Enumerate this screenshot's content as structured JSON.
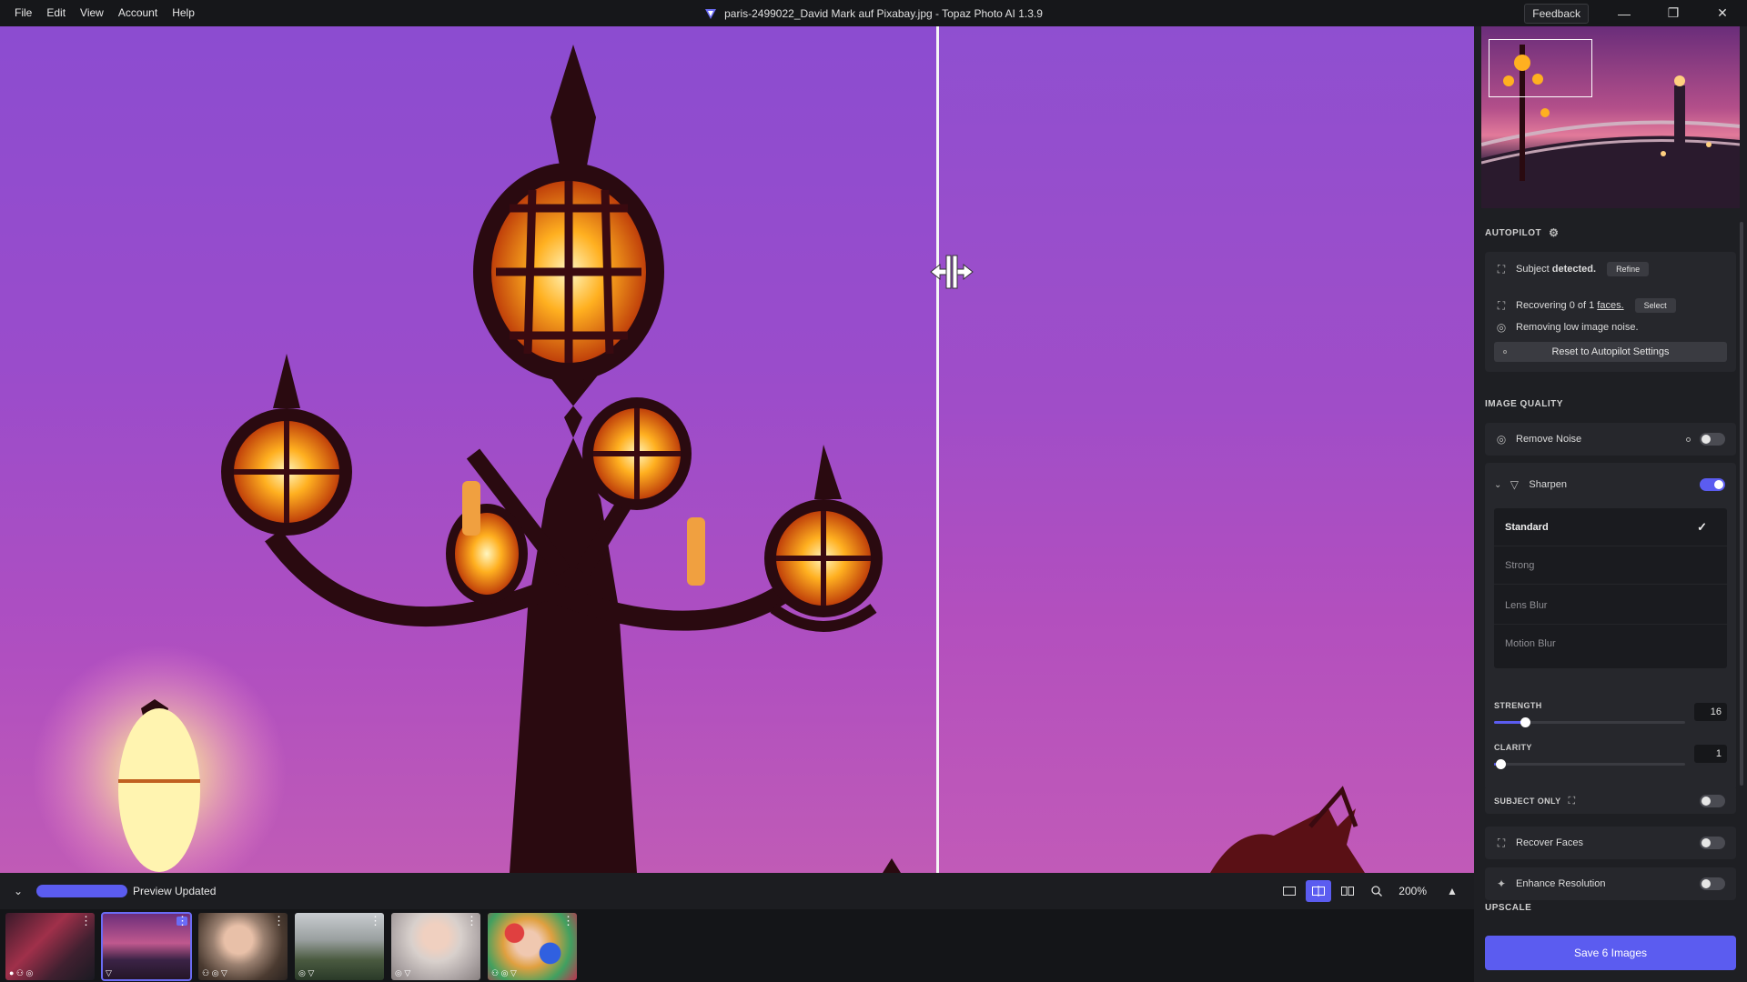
{
  "menu": [
    "File",
    "Edit",
    "View",
    "Account",
    "Help"
  ],
  "window_title": "paris-2499022_David Mark auf Pixabay.jpg - Topaz Photo AI 1.3.9",
  "feedback_label": "Feedback",
  "window_controls": {
    "minimize": "—",
    "restore": "❐",
    "close": "✕"
  },
  "colors": {
    "accent": "#5b5cf0",
    "panel": "#1e1f23",
    "sky_top": "#8f4fd0",
    "sky_bottom": "#c15ab8"
  },
  "bottom_bar": {
    "status": "Preview Updated",
    "progress": 1.0,
    "zoom": "200%"
  },
  "filmstrip": [
    {
      "name": "street-night",
      "selected": false
    },
    {
      "name": "paris-bridge",
      "selected": true
    },
    {
      "name": "baby-portrait",
      "selected": false
    },
    {
      "name": "landscape-tree",
      "selected": false
    },
    {
      "name": "child-portrait",
      "selected": false
    },
    {
      "name": "toddler-balls",
      "selected": false
    }
  ],
  "panel": {
    "autopilot": {
      "label": "AUTOPILOT",
      "subject_prefix": "Subject",
      "subject_suffix": "detected.",
      "refine_label": "Refine",
      "faces_text": "Recovering 0 of 1",
      "faces_link": "faces.",
      "select_label": "Select",
      "noise_text": "Removing low image noise.",
      "reset_label": "Reset to Autopilot Settings"
    },
    "image_quality": {
      "label": "IMAGE QUALITY",
      "remove_noise": "Remove Noise",
      "sharpen": "Sharpen",
      "models": [
        "Standard",
        "Strong",
        "Lens Blur",
        "Motion Blur"
      ],
      "selected_model": 0,
      "strength_label": "STRENGTH",
      "strength_value": "16",
      "strength_fraction": 0.16,
      "clarity_label": "CLARITY",
      "clarity_value": "1",
      "clarity_fraction": 0.01,
      "subject_only_label": "SUBJECT ONLY",
      "recover_faces": "Recover Faces",
      "enhance_resolution": "Enhance Resolution"
    },
    "upscale_label": "UPSCALE",
    "save_label": "Save 6 Images"
  }
}
